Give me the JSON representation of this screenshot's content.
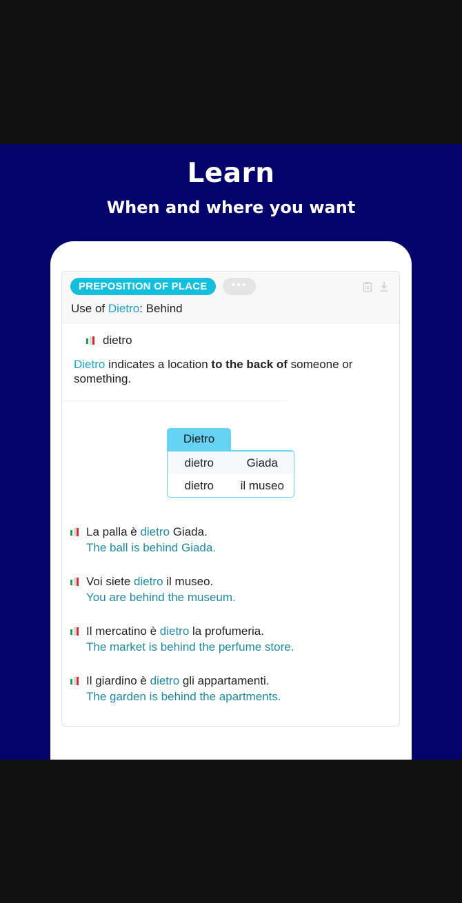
{
  "promo": {
    "title": "Learn",
    "subtitle": "When and where you want"
  },
  "card": {
    "category": "PREPOSITION OF PLACE",
    "more_label": "•••",
    "heading_prefix": "Use of ",
    "heading_word": "Dietro",
    "heading_suffix": ": Behind",
    "word": "dietro",
    "definition": {
      "word": "Dietro",
      "pre": " indicates a location ",
      "bold": "to the back of",
      "post": " someone or something."
    },
    "table": {
      "header": "Dietro",
      "rows": [
        [
          "dietro",
          "Giada"
        ],
        [
          "dietro",
          "il museo"
        ]
      ]
    },
    "examples": [
      {
        "it_pre": "La palla è ",
        "it_hl": "dietro",
        "it_post": " Giada.",
        "en": "The ball is behind Giada."
      },
      {
        "it_pre": "Voi siete ",
        "it_hl": "dietro",
        "it_post": " il museo.",
        "en": "You are behind the museum."
      },
      {
        "it_pre": "Il mercatino è ",
        "it_hl": "dietro",
        "it_post": " la profumeria.",
        "en": "The market is behind the perfume store."
      },
      {
        "it_pre": "Il giardino è ",
        "it_hl": "dietro",
        "it_post": " gli appartamenti.",
        "en": "The garden is behind the apartments."
      }
    ]
  },
  "icons": {
    "copy": "clipboard-icon",
    "download": "download-icon",
    "flag": "italy-flag-icon"
  },
  "colors": {
    "promo_bg": "#03036b",
    "accent": "#12bfdc",
    "teal_text": "#1b8aa3",
    "table_accent": "#66d3f5"
  }
}
